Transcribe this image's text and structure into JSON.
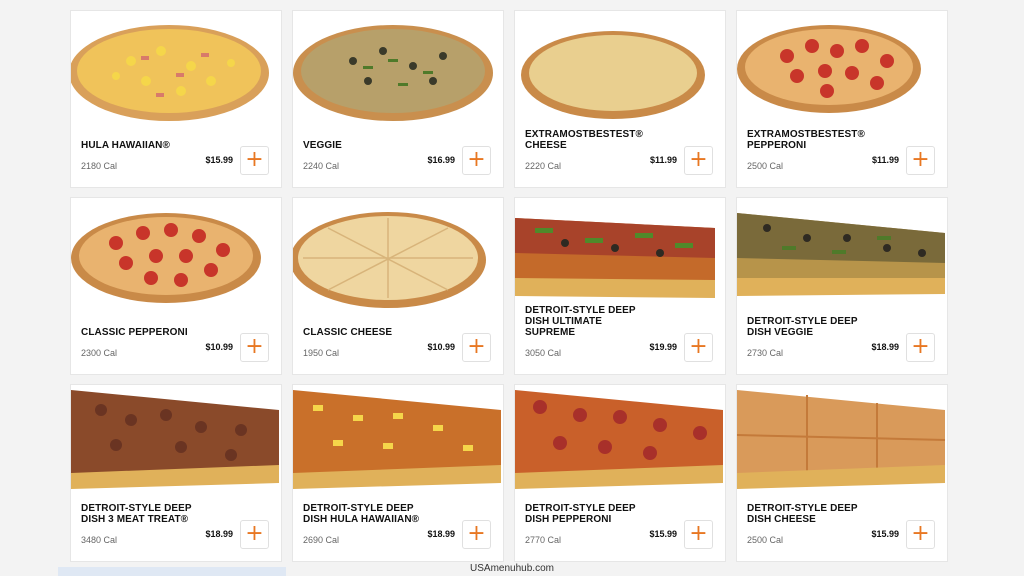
{
  "colors": {
    "accent": "#e87722",
    "card_bg": "#ffffff",
    "page_bg": "#f3f3f3"
  },
  "add_icon": "plus-icon",
  "items": [
    {
      "name": "HULA HAWAIIAN®",
      "cal": "2180 Cal",
      "price": "$15.99",
      "plus": "+"
    },
    {
      "name": "VEGGIE",
      "cal": "2240 Cal",
      "price": "$16.99",
      "plus": "+"
    },
    {
      "name": "EXTRAMOSTBESTEST® CHEESE",
      "cal": "2220 Cal",
      "price": "$11.99",
      "plus": "+"
    },
    {
      "name": "EXTRAMOSTBESTEST® PEPPERONI",
      "cal": "2500 Cal",
      "price": "$11.99",
      "plus": "+"
    },
    {
      "name": "CLASSIC PEPPERONI",
      "cal": "2300 Cal",
      "price": "$10.99",
      "plus": "+"
    },
    {
      "name": "CLASSIC CHEESE",
      "cal": "1950 Cal",
      "price": "$10.99",
      "plus": "+"
    },
    {
      "name": "DETROIT-STYLE DEEP DISH ULTIMATE SUPREME",
      "cal": "3050 Cal",
      "price": "$19.99",
      "plus": "+"
    },
    {
      "name": "DETROIT-STYLE DEEP DISH VEGGIE",
      "cal": "2730 Cal",
      "price": "$18.99",
      "plus": "+"
    },
    {
      "name": "DETROIT-STYLE DEEP DISH 3 MEAT TREAT®",
      "cal": "3480 Cal",
      "price": "$18.99",
      "plus": "+"
    },
    {
      "name": "DETROIT-STYLE DEEP DISH HULA HAWAIIAN®",
      "cal": "2690 Cal",
      "price": "$18.99",
      "plus": "+"
    },
    {
      "name": "DETROIT-STYLE DEEP DISH PEPPERONI",
      "cal": "2770 Cal",
      "price": "$15.99",
      "plus": "+"
    },
    {
      "name": "DETROIT-STYLE DEEP DISH CHEESE",
      "cal": "2500 Cal",
      "price": "$15.99",
      "plus": "+"
    }
  ],
  "footer": {
    "watermark": "USAmenuhub.com"
  }
}
